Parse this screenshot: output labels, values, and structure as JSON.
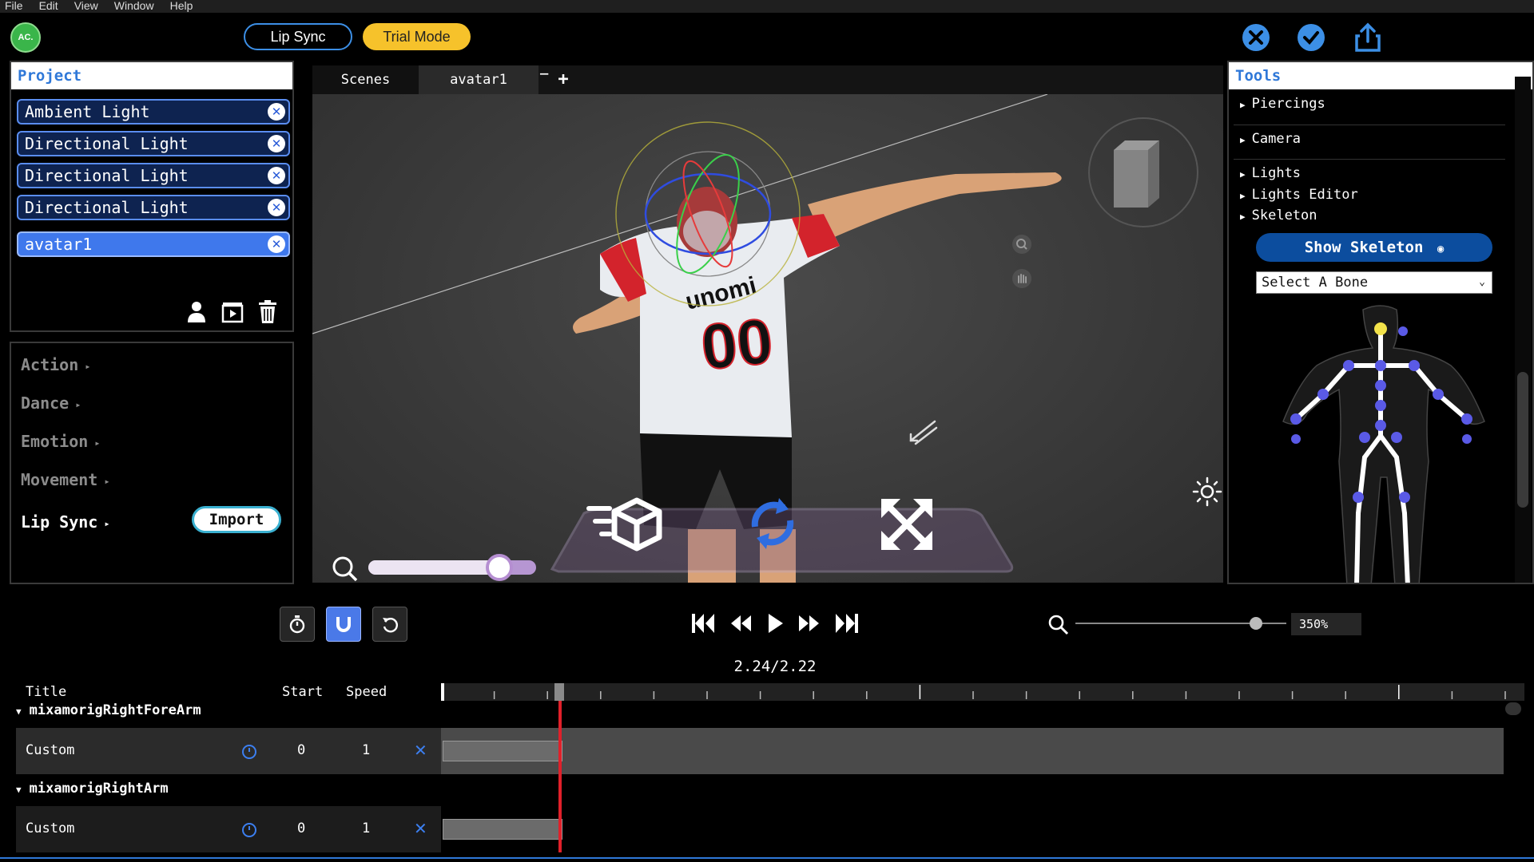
{
  "menu": [
    "File",
    "Edit",
    "View",
    "Window",
    "Help"
  ],
  "header": {
    "logo_text": "AC.",
    "lipsync_label": "Lip Sync",
    "trial_label": "Trial Mode"
  },
  "project": {
    "title": "Project",
    "items": [
      {
        "label": "Ambient Light"
      },
      {
        "label": "Directional Light"
      },
      {
        "label": "Directional Light"
      },
      {
        "label": "Directional Light"
      },
      {
        "label": "avatar1",
        "selected": true
      }
    ]
  },
  "categories": {
    "items": [
      "Action",
      "Dance",
      "Emotion",
      "Movement",
      "Lip Sync"
    ],
    "import_label": "Import"
  },
  "scene_tabs": {
    "tabs": [
      "Scenes",
      "avatar1"
    ],
    "minus": "−",
    "plus": "+"
  },
  "viewport": {
    "jersey_brand": "unomi",
    "jersey_number": "00"
  },
  "tools": {
    "title": "Tools",
    "items": [
      "Piercings",
      "Camera",
      "Lights",
      "Lights Editor",
      "Skeleton"
    ],
    "show_skeleton_label": "Show Skeleton",
    "bone_select_value": "Select A Bone"
  },
  "transport": {
    "zoom_value": "350%",
    "time_display": "2.24/2.22"
  },
  "timeline": {
    "headers": {
      "title": "Title",
      "start": "Start",
      "speed": "Speed"
    },
    "groups": [
      {
        "name": "mixamorigRightForeArm",
        "row": {
          "title": "Custom",
          "start": "0",
          "speed": "1"
        }
      },
      {
        "name": "mixamorigRightArm",
        "row": {
          "title": "Custom",
          "start": "0",
          "speed": "1"
        }
      }
    ]
  },
  "colors": {
    "accent_blue": "#3c8fe6",
    "trial_yellow": "#f6c22b",
    "playhead_red": "#e0202a",
    "tools_head": "#2f78d8"
  }
}
